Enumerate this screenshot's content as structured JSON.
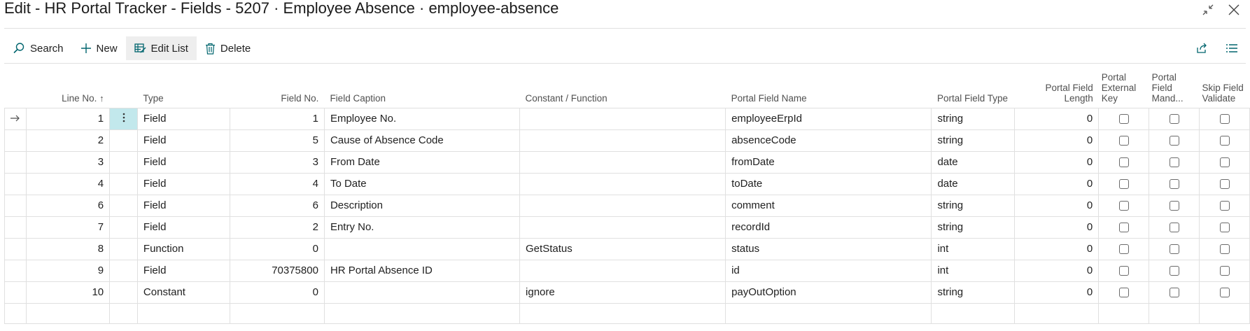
{
  "window": {
    "title": "Edit - HR Portal Tracker - Fields - 5207 · Employee Absence · employee-absence"
  },
  "toolbar": {
    "search_label": "Search",
    "new_label": "New",
    "edit_list_label": "Edit List",
    "delete_label": "Delete"
  },
  "columns": {
    "line_no": "Line No.",
    "type": "Type",
    "field_no": "Field No.",
    "field_caption": "Field Caption",
    "constant_function": "Constant / Function",
    "portal_field_name": "Portal Field Name",
    "portal_field_type": "Portal Field Type",
    "portal_field_length": "Portal Field Length",
    "portal_external_key": "Portal External Key",
    "portal_field_mand": "Portal Field Mand...",
    "skip_field_validate": "Skip Field Validate"
  },
  "rows": [
    {
      "line_no": "1",
      "type": "Field",
      "field_no": "1",
      "field_caption": "Employee No.",
      "constant_function": "",
      "portal_field_name": "employeeErpId",
      "portal_field_type": "string",
      "portal_field_length": "0",
      "external_key": false,
      "mandatory": false,
      "skip_validate": false
    },
    {
      "line_no": "2",
      "type": "Field",
      "field_no": "5",
      "field_caption": "Cause of Absence Code",
      "constant_function": "",
      "portal_field_name": "absenceCode",
      "portal_field_type": "string",
      "portal_field_length": "0",
      "external_key": false,
      "mandatory": false,
      "skip_validate": false
    },
    {
      "line_no": "3",
      "type": "Field",
      "field_no": "3",
      "field_caption": "From Date",
      "constant_function": "",
      "portal_field_name": "fromDate",
      "portal_field_type": "date",
      "portal_field_length": "0",
      "external_key": false,
      "mandatory": false,
      "skip_validate": false
    },
    {
      "line_no": "4",
      "type": "Field",
      "field_no": "4",
      "field_caption": "To Date",
      "constant_function": "",
      "portal_field_name": "toDate",
      "portal_field_type": "date",
      "portal_field_length": "0",
      "external_key": false,
      "mandatory": false,
      "skip_validate": false
    },
    {
      "line_no": "6",
      "type": "Field",
      "field_no": "6",
      "field_caption": "Description",
      "constant_function": "",
      "portal_field_name": "comment",
      "portal_field_type": "string",
      "portal_field_length": "0",
      "external_key": false,
      "mandatory": false,
      "skip_validate": false
    },
    {
      "line_no": "7",
      "type": "Field",
      "field_no": "2",
      "field_caption": "Entry No.",
      "constant_function": "",
      "portal_field_name": "recordId",
      "portal_field_type": "string",
      "portal_field_length": "0",
      "external_key": false,
      "mandatory": false,
      "skip_validate": false
    },
    {
      "line_no": "8",
      "type": "Function",
      "field_no": "0",
      "field_caption": "",
      "constant_function": "GetStatus",
      "portal_field_name": "status",
      "portal_field_type": "int",
      "portal_field_length": "0",
      "external_key": false,
      "mandatory": false,
      "skip_validate": false
    },
    {
      "line_no": "9",
      "type": "Field",
      "field_no": "70375800",
      "field_caption": "HR Portal Absence ID",
      "constant_function": "",
      "portal_field_name": "id",
      "portal_field_type": "int",
      "portal_field_length": "0",
      "external_key": false,
      "mandatory": false,
      "skip_validate": false
    },
    {
      "line_no": "10",
      "type": "Constant",
      "field_no": "0",
      "field_caption": "",
      "constant_function": "ignore",
      "portal_field_name": "payOutOption",
      "portal_field_type": "string",
      "portal_field_length": "0",
      "external_key": false,
      "mandatory": false,
      "skip_validate": false
    }
  ],
  "icons": {
    "search": "search-icon",
    "new": "plus-icon",
    "edit_list": "edit-list-icon",
    "delete": "trash-icon",
    "share": "share-icon",
    "list_view": "list-view-icon",
    "collapse": "collapse-icon",
    "close": "close-icon",
    "row_marker": "arrow-right-icon",
    "row_menu": "more-vertical-icon",
    "sort": "sort-ascending-icon"
  },
  "colors": {
    "accent": "#00656e",
    "selected_cell": "#c2e8ec",
    "toolbar_active": "#eeeeee",
    "grid_border": "#e0e0e0"
  }
}
